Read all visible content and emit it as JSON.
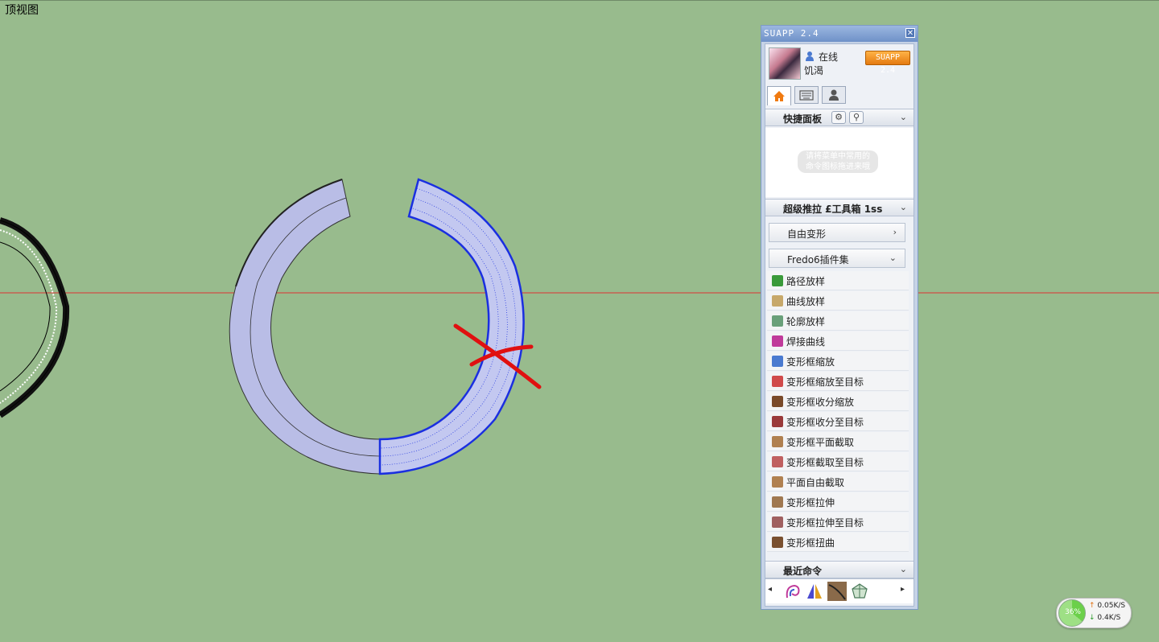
{
  "viewport": {
    "view_label": "顶视图",
    "axis_color": "#d33",
    "background": "#98bb8d"
  },
  "suapp": {
    "title": "SUAPP 2.4",
    "close_icon": "close-icon",
    "user": {
      "status": "在线",
      "name": "饥渴",
      "badge": "SUAPP 2.4"
    },
    "tabs": [
      "home-icon",
      "keyboard-icon",
      "user-icon"
    ],
    "quick_panel": {
      "title": "快捷面板",
      "hint_line1": "请将菜单中常用的",
      "hint_line2": "命令图标拖进来哦"
    },
    "toolbox": {
      "title": "超级推拉 £工具箱 1ss"
    },
    "groups": [
      {
        "label": "自由变形",
        "chevron": "›"
      },
      {
        "label": "Fredo6插件集",
        "chevron": "⌄"
      }
    ],
    "commands": [
      {
        "label": "路径放样",
        "icon": "path-loft-icon",
        "color": "#3a9a3a"
      },
      {
        "label": "曲线放样",
        "icon": "curve-loft-icon",
        "color": "#c7a86a"
      },
      {
        "label": "轮廓放样",
        "icon": "skin-loft-icon",
        "color": "#6aa07a"
      },
      {
        "label": "焊接曲线",
        "icon": "weld-curve-icon",
        "color": "#c03a9a"
      },
      {
        "label": "变形框缩放",
        "icon": "box-scale-icon",
        "color": "#4a7ad0"
      },
      {
        "label": "变形框缩放至目标",
        "icon": "box-scale-target-icon",
        "color": "#d04a4a"
      },
      {
        "label": "变形框收分缩放",
        "icon": "box-taper-icon",
        "color": "#7a4a2a"
      },
      {
        "label": "变形框收分至目标",
        "icon": "box-taper-target-icon",
        "color": "#9a3a3a"
      },
      {
        "label": "变形框平面截取",
        "icon": "box-plane-cut-icon",
        "color": "#b08050"
      },
      {
        "label": "变形框截取至目标",
        "icon": "box-cut-target-icon",
        "color": "#c06060"
      },
      {
        "label": "平面自由截取",
        "icon": "plane-free-cut-icon",
        "color": "#b08050"
      },
      {
        "label": "变形框拉伸",
        "icon": "box-stretch-icon",
        "color": "#a07850"
      },
      {
        "label": "变形框拉伸至目标",
        "icon": "box-stretch-target-icon",
        "color": "#a06060"
      },
      {
        "label": "变形框扭曲",
        "icon": "box-twist-icon",
        "color": "#7a5030"
      }
    ],
    "recent": {
      "title": "最近命令",
      "icons": [
        "weld-curve-icon",
        "mirror-icon",
        "curve-icon",
        "skin-loft-icon"
      ]
    }
  },
  "network": {
    "percent": "36%",
    "up": "0.05K/S",
    "down": "0.4K/S"
  }
}
